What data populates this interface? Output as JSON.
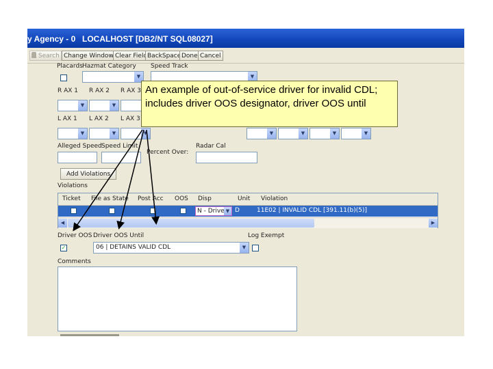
{
  "window": {
    "title_left": "y Agency - 0",
    "title_host": "LOCALHOST [DB2/NT SQL08027]"
  },
  "toolbar": {
    "search": "Search",
    "change_window": "Change Window",
    "clear_field": "Clear Field",
    "backspace": "BackSpace",
    "done": "Done",
    "cancel": "Cancel"
  },
  "labels": {
    "placards": "Placards",
    "hazmat_category": "Hazmat Category",
    "speed_track": "Speed Track",
    "r_ax1": "R AX 1",
    "r_ax2": "R AX 2",
    "r_ax3": "R AX 3",
    "l_ax1": "L AX 1",
    "l_ax2": "L AX 2",
    "l_ax3": "L AX 3",
    "alleged_speed": "Alleged Speed",
    "speed_limit": "Speed Limit",
    "percent_over": "Percent Over:",
    "radar_cal": "Radar Cal",
    "violations": "Violations",
    "driver_oos": "Driver OOS",
    "driver_oos_until": "Driver OOS Until",
    "log_exempt": "Log Exempt",
    "comments": "Comments"
  },
  "buttons": {
    "add_violations": "Add Violations"
  },
  "violations_grid": {
    "headers": [
      "Ticket",
      "File as State",
      "Post Acc",
      "OOS",
      "Disp",
      "Unit",
      "Violation"
    ],
    "row": {
      "disp": "N - Driver",
      "unit": "D",
      "violation": "11E02 | INVALID CDL   [391.11(b)(5)]"
    }
  },
  "driver_oos_until": {
    "value": "06 | DETAINS VALID CDL"
  },
  "checkboxes": {
    "driver_oos_checked": "✓"
  },
  "callout": {
    "text": "An example of out-of-service driver for invalid CDL; includes driver OOS designator, driver OOS until"
  },
  "colors": {
    "titlebar": "#1246b8",
    "window_bg": "#ece9d8",
    "selection": "#316ac5",
    "callout_bg": "#ffffb0"
  }
}
